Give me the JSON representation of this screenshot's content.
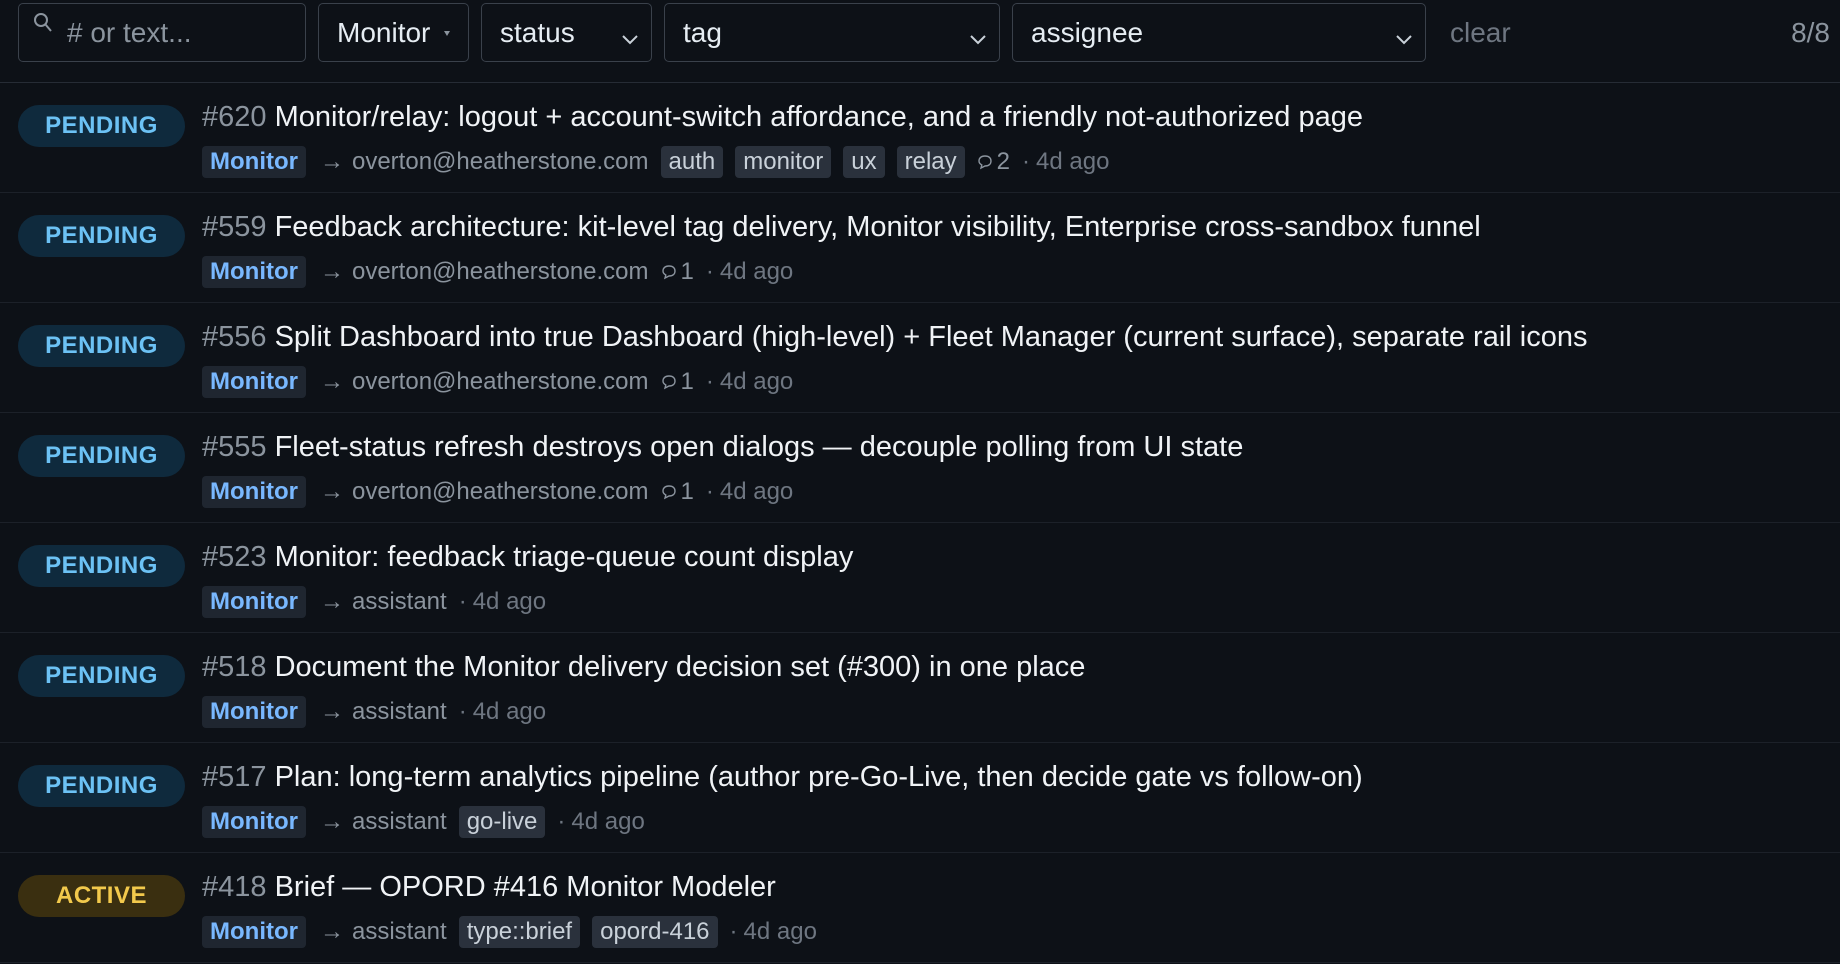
{
  "filters": {
    "search_placeholder": "# or text...",
    "project": "Monitor",
    "status": "status",
    "tag": "tag",
    "assignee": "assignee",
    "clear_label": "clear",
    "count": "8/8"
  },
  "colors": {
    "background": "#0d1117",
    "pending_badge_text": "#6cc2f5",
    "active_badge_text": "#f2c94c",
    "project_chip_text": "#79b8ff"
  },
  "issues": [
    {
      "status": "PENDING",
      "number": "#620",
      "title": "Monitor/relay: logout + account-switch affordance, and a friendly not-authorized page",
      "project": "Monitor",
      "assignee": "overton@heatherstone.com",
      "tags": [
        "auth",
        "monitor",
        "ux",
        "relay"
      ],
      "comments": "2",
      "age": "4d ago"
    },
    {
      "status": "PENDING",
      "number": "#559",
      "title": "Feedback architecture: kit-level tag delivery, Monitor visibility, Enterprise cross-sandbox funnel",
      "project": "Monitor",
      "assignee": "overton@heatherstone.com",
      "tags": [],
      "comments": "1",
      "age": "4d ago"
    },
    {
      "status": "PENDING",
      "number": "#556",
      "title": "Split Dashboard into true Dashboard (high-level) + Fleet Manager (current surface), separate rail icons",
      "project": "Monitor",
      "assignee": "overton@heatherstone.com",
      "tags": [],
      "comments": "1",
      "age": "4d ago"
    },
    {
      "status": "PENDING",
      "number": "#555",
      "title": "Fleet-status refresh destroys open dialogs — decouple polling from UI state",
      "project": "Monitor",
      "assignee": "overton@heatherstone.com",
      "tags": [],
      "comments": "1",
      "age": "4d ago"
    },
    {
      "status": "PENDING",
      "number": "#523",
      "title": "Monitor: feedback triage-queue count display",
      "project": "Monitor",
      "assignee": "assistant",
      "tags": [],
      "comments": "",
      "age": "4d ago"
    },
    {
      "status": "PENDING",
      "number": "#518",
      "title": "Document the Monitor delivery decision set (#300) in one place",
      "project": "Monitor",
      "assignee": "assistant",
      "tags": [],
      "comments": "",
      "age": "4d ago"
    },
    {
      "status": "PENDING",
      "number": "#517",
      "title": "Plan: long-term analytics pipeline (author pre-Go-Live, then decide gate vs follow-on)",
      "project": "Monitor",
      "assignee": "assistant",
      "tags": [
        "go-live"
      ],
      "comments": "",
      "age": "4d ago"
    },
    {
      "status": "ACTIVE",
      "number": "#418",
      "title": "Brief — OPORD #416 Monitor Modeler",
      "project": "Monitor",
      "assignee": "assistant",
      "tags": [
        "type::brief",
        "opord-416"
      ],
      "comments": "",
      "age": "4d ago"
    }
  ]
}
